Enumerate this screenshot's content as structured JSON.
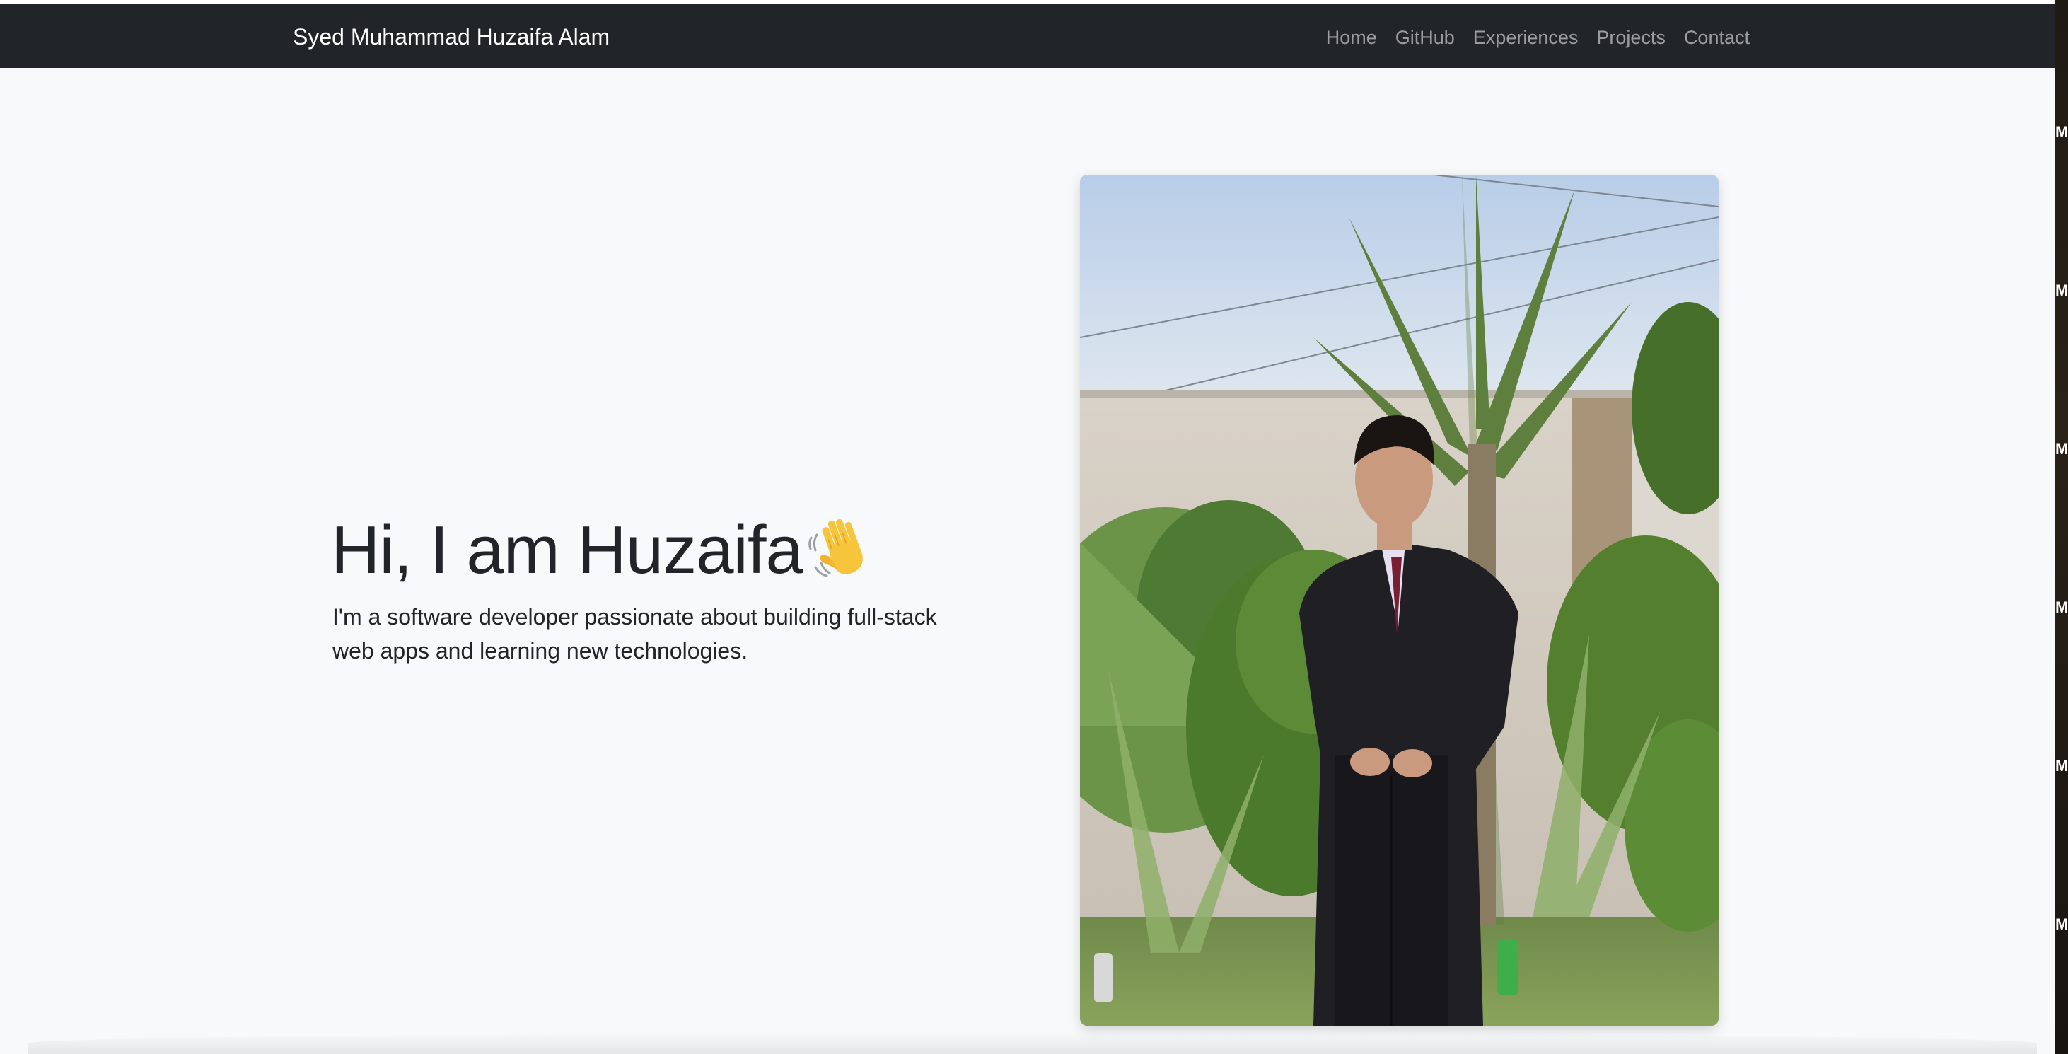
{
  "navbar": {
    "brand": "Syed Muhammad Huzaifa Alam",
    "links": [
      "Home",
      "GitHub",
      "Experiences",
      "Projects",
      "Contact"
    ]
  },
  "hero": {
    "title": "Hi, I am Huzaifa",
    "title_icon": "waving-hand-icon",
    "subtitle": "I'm a software developer passionate about building full-stack web apps and learning new technologies."
  },
  "profile_photo": {
    "subject": "person in dark suit standing among palm plants"
  },
  "side_strip": {
    "labels": [
      "M",
      "M",
      "M",
      "M",
      "M",
      "M"
    ]
  },
  "colors": {
    "navbar_bg": "#212529",
    "page_bg": "#f8f9fa",
    "text": "#212529",
    "nav_link": "rgba(255,255,255,0.55)"
  }
}
